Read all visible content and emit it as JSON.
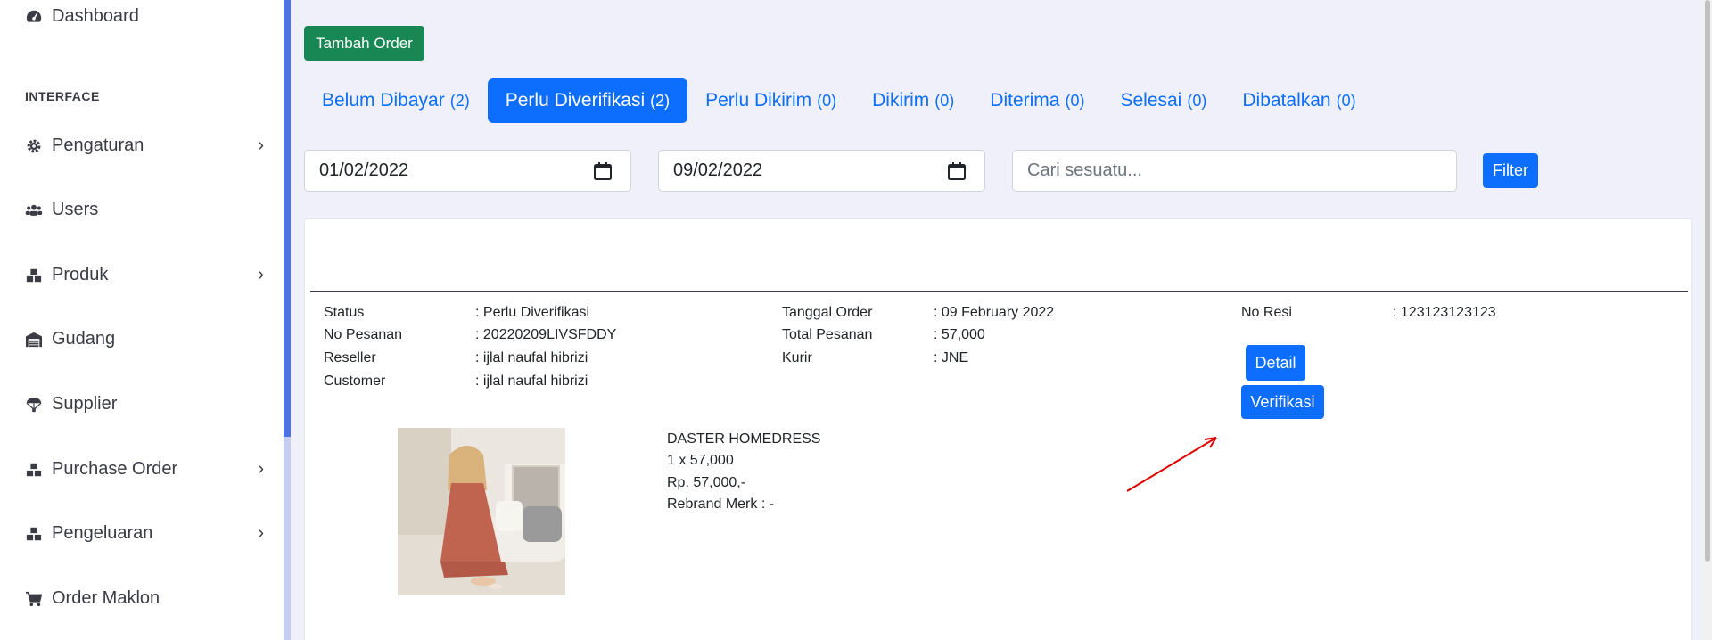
{
  "sidebar": {
    "items": [
      {
        "label": "Dashboard",
        "icon": "dashboard-icon"
      },
      {
        "label": "Pengaturan",
        "icon": "gear-icon",
        "chevron": true
      },
      {
        "label": "Users",
        "icon": "users-icon"
      },
      {
        "label": "Produk",
        "icon": "boxes-icon",
        "chevron": true
      },
      {
        "label": "Gudang",
        "icon": "warehouse-icon"
      },
      {
        "label": "Supplier",
        "icon": "parachute-icon"
      },
      {
        "label": "Purchase Order",
        "icon": "boxes-icon",
        "chevron": true
      },
      {
        "label": "Pengeluaran",
        "icon": "boxes-icon",
        "chevron": true
      },
      {
        "label": "Order Maklon",
        "icon": "cart-icon"
      }
    ],
    "heading": "INTERFACE"
  },
  "main": {
    "add_order_label": "Tambah Order",
    "tabs": [
      {
        "label": "Belum Dibayar",
        "count": "(2)"
      },
      {
        "label": "Perlu Diverifikasi",
        "count": "(2)",
        "active": true
      },
      {
        "label": "Perlu Dikirim",
        "count": "(0)"
      },
      {
        "label": "Dikirim",
        "count": "(0)"
      },
      {
        "label": "Diterima",
        "count": "(0)"
      },
      {
        "label": "Selesai",
        "count": "(0)"
      },
      {
        "label": "Dibatalkan",
        "count": "(0)"
      }
    ],
    "date_from": "01/02/2022",
    "date_to": "09/02/2022",
    "search_placeholder": "Cari sesuatu...",
    "filter_label": "Filter"
  },
  "order": {
    "status_label": "Status",
    "status_value": ": Perlu Diverifikasi",
    "no_pesanan_label": "No Pesanan",
    "no_pesanan_value": ": 20220209LIVSFDDY",
    "reseller_label": "Reseller",
    "reseller_value": ": ijlal naufal hibrizi",
    "customer_label": "Customer",
    "customer_value": ": ijlal naufal hibrizi",
    "tanggal_label": "Tanggal Order",
    "tanggal_value": ": 09 February 2022",
    "total_label": "Total Pesanan",
    "total_value": ": 57,000",
    "kurir_label": "Kurir",
    "kurir_value": ": JNE",
    "resi_label": "No Resi",
    "resi_value": ": 123123123123",
    "detail_label": "Detail",
    "verify_label": "Verifikasi"
  },
  "product": {
    "name": "DASTER HOMEDRESS",
    "qty": "1 x 57,000",
    "price": "Rp. 57,000,-",
    "rebrand": "Rebrand Merk : -"
  },
  "colors": {
    "primary": "#0d6efd",
    "success": "#198754",
    "sidebar_accent": "#4e73df",
    "arrow": "#e00000"
  }
}
